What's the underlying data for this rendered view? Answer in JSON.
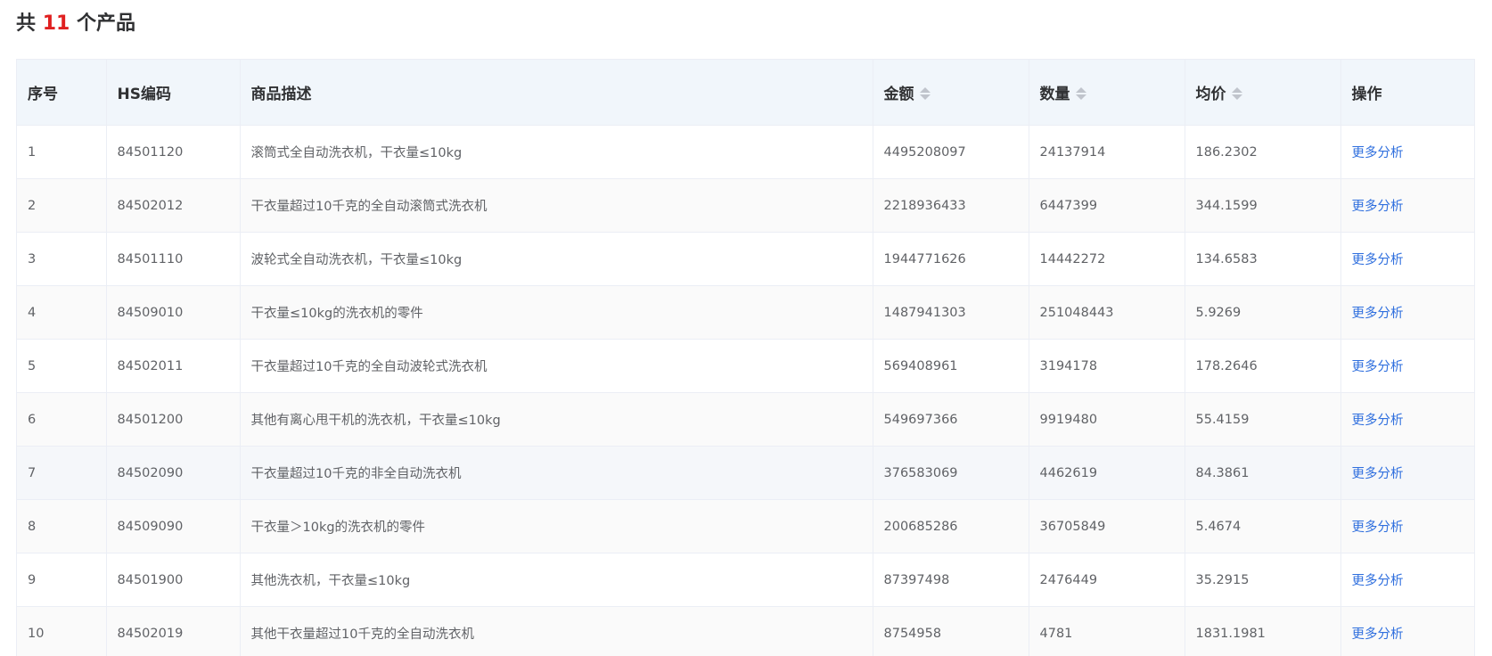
{
  "summary": {
    "prefix": "共",
    "count": "11",
    "suffix": "个产品"
  },
  "table": {
    "headers": {
      "index": "序号",
      "hs": "HS编码",
      "desc": "商品描述",
      "amount": "金额",
      "quantity": "数量",
      "unit_price": "均价",
      "action": "操作"
    },
    "rows": [
      {
        "index": "1",
        "hs": "84501120",
        "desc": "滚筒式全自动洗衣机，干衣量≤10kg",
        "amount": "4495208097",
        "quantity": "24137914",
        "unit_price": "186.2302",
        "action": "更多分析"
      },
      {
        "index": "2",
        "hs": "84502012",
        "desc": "干衣量超过10千克的全自动滚筒式洗衣机",
        "amount": "2218936433",
        "quantity": "6447399",
        "unit_price": "344.1599",
        "action": "更多分析"
      },
      {
        "index": "3",
        "hs": "84501110",
        "desc": "波轮式全自动洗衣机，干衣量≤10kg",
        "amount": "1944771626",
        "quantity": "14442272",
        "unit_price": "134.6583",
        "action": "更多分析"
      },
      {
        "index": "4",
        "hs": "84509010",
        "desc": "干衣量≤10kg的洗衣机的零件",
        "amount": "1487941303",
        "quantity": "251048443",
        "unit_price": "5.9269",
        "action": "更多分析"
      },
      {
        "index": "5",
        "hs": "84502011",
        "desc": "干衣量超过10千克的全自动波轮式洗衣机",
        "amount": "569408961",
        "quantity": "3194178",
        "unit_price": "178.2646",
        "action": "更多分析"
      },
      {
        "index": "6",
        "hs": "84501200",
        "desc": "其他有离心甩干机的洗衣机，干衣量≤10kg",
        "amount": "549697366",
        "quantity": "9919480",
        "unit_price": "55.4159",
        "action": "更多分析"
      },
      {
        "index": "7",
        "hs": "84502090",
        "desc": "干衣量超过10千克的非全自动洗衣机",
        "amount": "376583069",
        "quantity": "4462619",
        "unit_price": "84.3861",
        "action": "更多分析"
      },
      {
        "index": "8",
        "hs": "84509090",
        "desc": "干衣量＞10kg的洗衣机的零件",
        "amount": "200685286",
        "quantity": "36705849",
        "unit_price": "5.4674",
        "action": "更多分析"
      },
      {
        "index": "9",
        "hs": "84501900",
        "desc": "其他洗衣机，干衣量≤10kg",
        "amount": "87397498",
        "quantity": "2476449",
        "unit_price": "35.2915",
        "action": "更多分析"
      },
      {
        "index": "10",
        "hs": "84502019",
        "desc": "其他干衣量超过10千克的全自动洗衣机",
        "amount": "8754958",
        "quantity": "4781",
        "unit_price": "1831.1981",
        "action": "更多分析"
      }
    ]
  }
}
